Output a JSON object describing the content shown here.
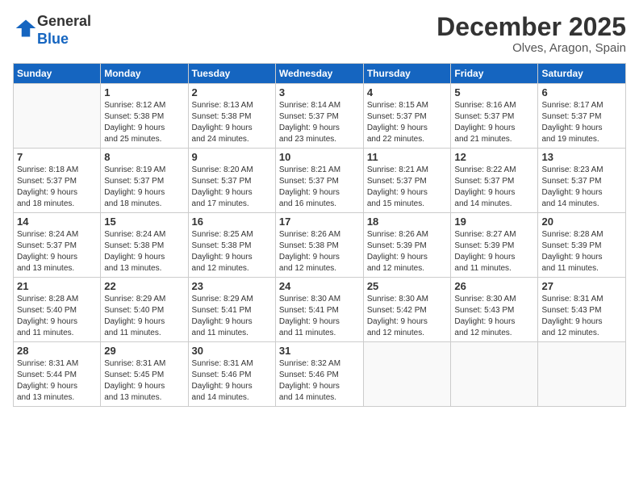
{
  "logo": {
    "general": "General",
    "blue": "Blue"
  },
  "title": "December 2025",
  "location": "Olves, Aragon, Spain",
  "days_header": [
    "Sunday",
    "Monday",
    "Tuesday",
    "Wednesday",
    "Thursday",
    "Friday",
    "Saturday"
  ],
  "weeks": [
    [
      {
        "day": "",
        "info": ""
      },
      {
        "day": "1",
        "info": "Sunrise: 8:12 AM\nSunset: 5:38 PM\nDaylight: 9 hours\nand 25 minutes."
      },
      {
        "day": "2",
        "info": "Sunrise: 8:13 AM\nSunset: 5:38 PM\nDaylight: 9 hours\nand 24 minutes."
      },
      {
        "day": "3",
        "info": "Sunrise: 8:14 AM\nSunset: 5:37 PM\nDaylight: 9 hours\nand 23 minutes."
      },
      {
        "day": "4",
        "info": "Sunrise: 8:15 AM\nSunset: 5:37 PM\nDaylight: 9 hours\nand 22 minutes."
      },
      {
        "day": "5",
        "info": "Sunrise: 8:16 AM\nSunset: 5:37 PM\nDaylight: 9 hours\nand 21 minutes."
      },
      {
        "day": "6",
        "info": "Sunrise: 8:17 AM\nSunset: 5:37 PM\nDaylight: 9 hours\nand 19 minutes."
      }
    ],
    [
      {
        "day": "7",
        "info": "Sunrise: 8:18 AM\nSunset: 5:37 PM\nDaylight: 9 hours\nand 18 minutes."
      },
      {
        "day": "8",
        "info": "Sunrise: 8:19 AM\nSunset: 5:37 PM\nDaylight: 9 hours\nand 18 minutes."
      },
      {
        "day": "9",
        "info": "Sunrise: 8:20 AM\nSunset: 5:37 PM\nDaylight: 9 hours\nand 17 minutes."
      },
      {
        "day": "10",
        "info": "Sunrise: 8:21 AM\nSunset: 5:37 PM\nDaylight: 9 hours\nand 16 minutes."
      },
      {
        "day": "11",
        "info": "Sunrise: 8:21 AM\nSunset: 5:37 PM\nDaylight: 9 hours\nand 15 minutes."
      },
      {
        "day": "12",
        "info": "Sunrise: 8:22 AM\nSunset: 5:37 PM\nDaylight: 9 hours\nand 14 minutes."
      },
      {
        "day": "13",
        "info": "Sunrise: 8:23 AM\nSunset: 5:37 PM\nDaylight: 9 hours\nand 14 minutes."
      }
    ],
    [
      {
        "day": "14",
        "info": "Sunrise: 8:24 AM\nSunset: 5:37 PM\nDaylight: 9 hours\nand 13 minutes."
      },
      {
        "day": "15",
        "info": "Sunrise: 8:24 AM\nSunset: 5:38 PM\nDaylight: 9 hours\nand 13 minutes."
      },
      {
        "day": "16",
        "info": "Sunrise: 8:25 AM\nSunset: 5:38 PM\nDaylight: 9 hours\nand 12 minutes."
      },
      {
        "day": "17",
        "info": "Sunrise: 8:26 AM\nSunset: 5:38 PM\nDaylight: 9 hours\nand 12 minutes."
      },
      {
        "day": "18",
        "info": "Sunrise: 8:26 AM\nSunset: 5:39 PM\nDaylight: 9 hours\nand 12 minutes."
      },
      {
        "day": "19",
        "info": "Sunrise: 8:27 AM\nSunset: 5:39 PM\nDaylight: 9 hours\nand 11 minutes."
      },
      {
        "day": "20",
        "info": "Sunrise: 8:28 AM\nSunset: 5:39 PM\nDaylight: 9 hours\nand 11 minutes."
      }
    ],
    [
      {
        "day": "21",
        "info": "Sunrise: 8:28 AM\nSunset: 5:40 PM\nDaylight: 9 hours\nand 11 minutes."
      },
      {
        "day": "22",
        "info": "Sunrise: 8:29 AM\nSunset: 5:40 PM\nDaylight: 9 hours\nand 11 minutes."
      },
      {
        "day": "23",
        "info": "Sunrise: 8:29 AM\nSunset: 5:41 PM\nDaylight: 9 hours\nand 11 minutes."
      },
      {
        "day": "24",
        "info": "Sunrise: 8:30 AM\nSunset: 5:41 PM\nDaylight: 9 hours\nand 11 minutes."
      },
      {
        "day": "25",
        "info": "Sunrise: 8:30 AM\nSunset: 5:42 PM\nDaylight: 9 hours\nand 12 minutes."
      },
      {
        "day": "26",
        "info": "Sunrise: 8:30 AM\nSunset: 5:43 PM\nDaylight: 9 hours\nand 12 minutes."
      },
      {
        "day": "27",
        "info": "Sunrise: 8:31 AM\nSunset: 5:43 PM\nDaylight: 9 hours\nand 12 minutes."
      }
    ],
    [
      {
        "day": "28",
        "info": "Sunrise: 8:31 AM\nSunset: 5:44 PM\nDaylight: 9 hours\nand 13 minutes."
      },
      {
        "day": "29",
        "info": "Sunrise: 8:31 AM\nSunset: 5:45 PM\nDaylight: 9 hours\nand 13 minutes."
      },
      {
        "day": "30",
        "info": "Sunrise: 8:31 AM\nSunset: 5:46 PM\nDaylight: 9 hours\nand 14 minutes."
      },
      {
        "day": "31",
        "info": "Sunrise: 8:32 AM\nSunset: 5:46 PM\nDaylight: 9 hours\nand 14 minutes."
      },
      {
        "day": "",
        "info": ""
      },
      {
        "day": "",
        "info": ""
      },
      {
        "day": "",
        "info": ""
      }
    ]
  ]
}
